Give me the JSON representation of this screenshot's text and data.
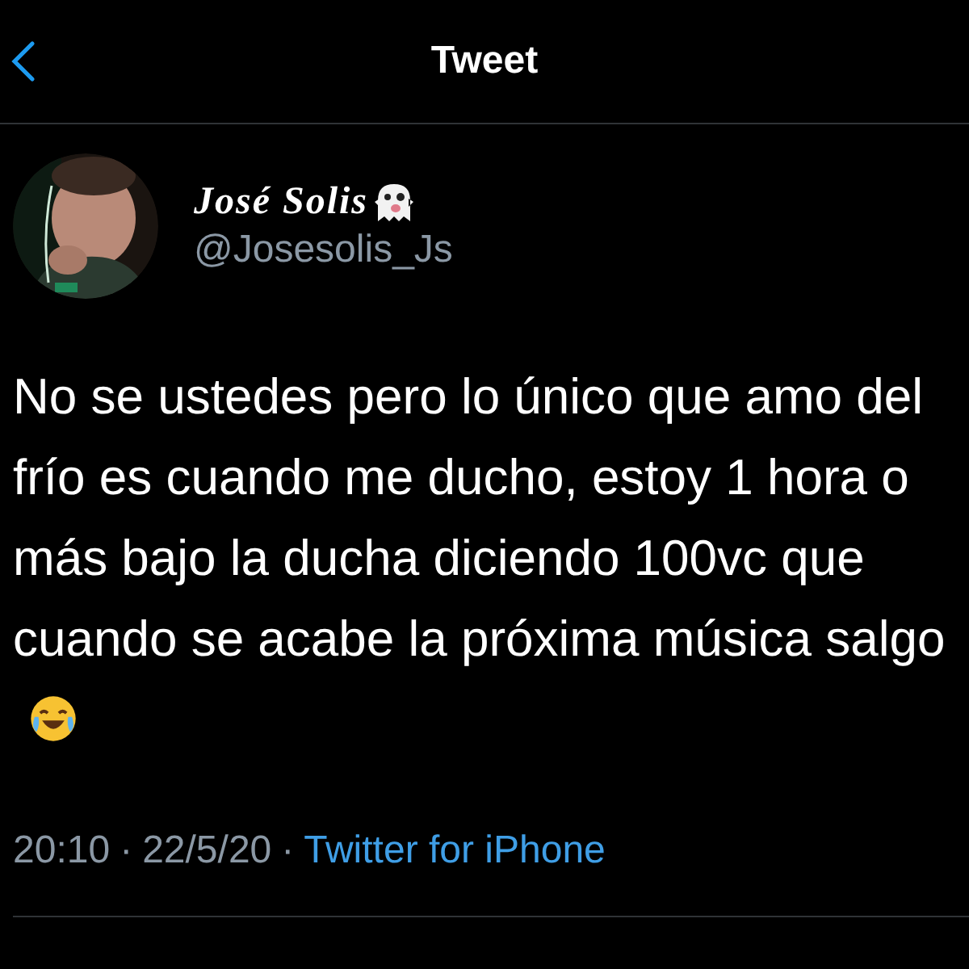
{
  "header": {
    "title": "Tweet"
  },
  "author": {
    "name": "José Solis",
    "handle": "@Josesolis_Js"
  },
  "tweet": {
    "text": "No se ustedes pero lo único que amo del frío es cuando me ducho, estoy 1 hora o más bajo la ducha diciendo 100vc que cuando se acabe la próxima música salgo"
  },
  "meta": {
    "time": "20:10",
    "separators": [
      "·",
      "·"
    ],
    "date": "22/5/20",
    "source": "Twitter for iPhone"
  }
}
